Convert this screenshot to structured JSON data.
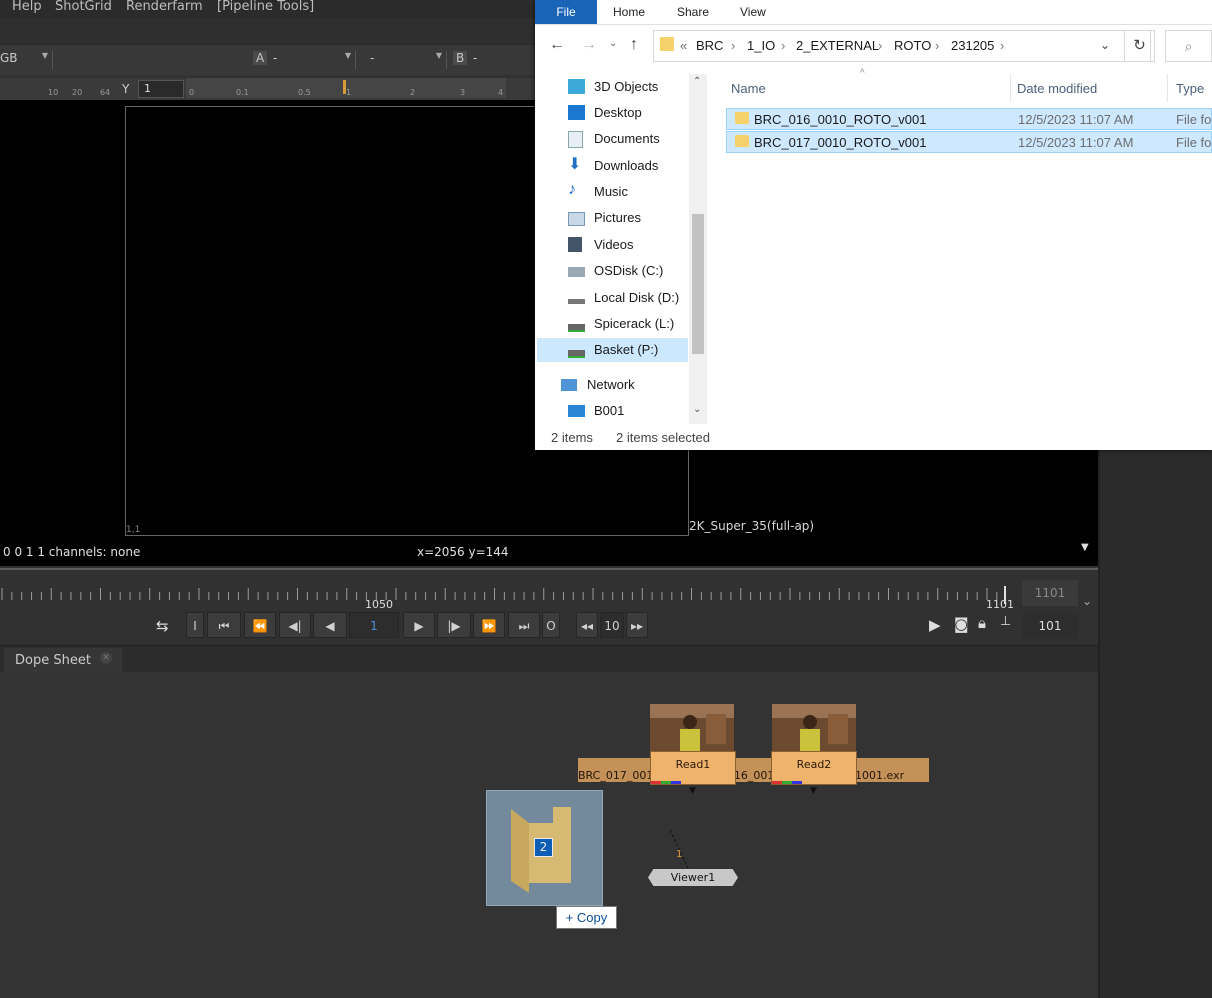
{
  "nuke": {
    "menu": [
      "Help",
      "ShotGrid",
      "Renderfarm",
      "[Pipeline Tools]"
    ],
    "toolbar": {
      "channel_partial": "GB",
      "a_label": "A",
      "a_value": "-",
      "mid_value": "-",
      "b_label": "B",
      "b_value": "-",
      "y_label": "Y",
      "y_value": "1"
    },
    "ruler_left_ticks": [
      "10",
      "20",
      "64"
    ],
    "ruler_right_ticks": [
      "0",
      "0.1",
      "0.5",
      "1",
      "2",
      "3",
      "4"
    ],
    "format_corner": "1,1",
    "format_name": "2K_Super_35(full-ap)",
    "info_left": "0 0 1 1 channels: none",
    "info_coords": "x=2056 y=144",
    "timeline": {
      "label_1050": "1050",
      "label_1101": "1101",
      "end_frame": "1101",
      "current_frame": "1",
      "increment": "10",
      "range_end": "101",
      "buttons": {
        "in": "I",
        "out": "O"
      }
    },
    "dopesheet_tab": "Dope Sheet",
    "nodes": {
      "read1": {
        "name": "Read1",
        "file": "BRC_017_0010_ROTO"
      },
      "read2": {
        "name": "Read2",
        "file": "BRC_016_0010_ROTO_v001.1001.exr"
      },
      "viewer": {
        "name": "Viewer1",
        "input": "1"
      }
    },
    "drag": {
      "count": "2",
      "action": "+ Copy"
    }
  },
  "explorer": {
    "ribbon_tabs": [
      "File",
      "Home",
      "Share",
      "View"
    ],
    "address": {
      "prefix": "«",
      "parts": [
        "BRC",
        "1_IO",
        "2_EXTERNAL",
        "ROTO",
        "231205"
      ]
    },
    "columns": {
      "name": "Name",
      "date": "Date modified",
      "type": "Type"
    },
    "nav": [
      "3D Objects",
      "Desktop",
      "Documents",
      "Downloads",
      "Music",
      "Pictures",
      "Videos",
      "OSDisk (C:)",
      "Local Disk (D:)",
      "Spicerack (L:)",
      "Basket (P:)",
      "Network",
      "B001"
    ],
    "files": [
      {
        "name": "BRC_016_0010_ROTO_v001",
        "date": "12/5/2023 11:07 AM",
        "type": "File fo"
      },
      {
        "name": "BRC_017_0010_ROTO_v001",
        "date": "12/5/2023 11:07 AM",
        "type": "File fo"
      }
    ],
    "status": {
      "count": "2 items",
      "selected": "2 items selected"
    }
  },
  "colors": {
    "accent": "#1a64b8",
    "selection": "#cde8ff",
    "read_node": "#f0b36b"
  }
}
